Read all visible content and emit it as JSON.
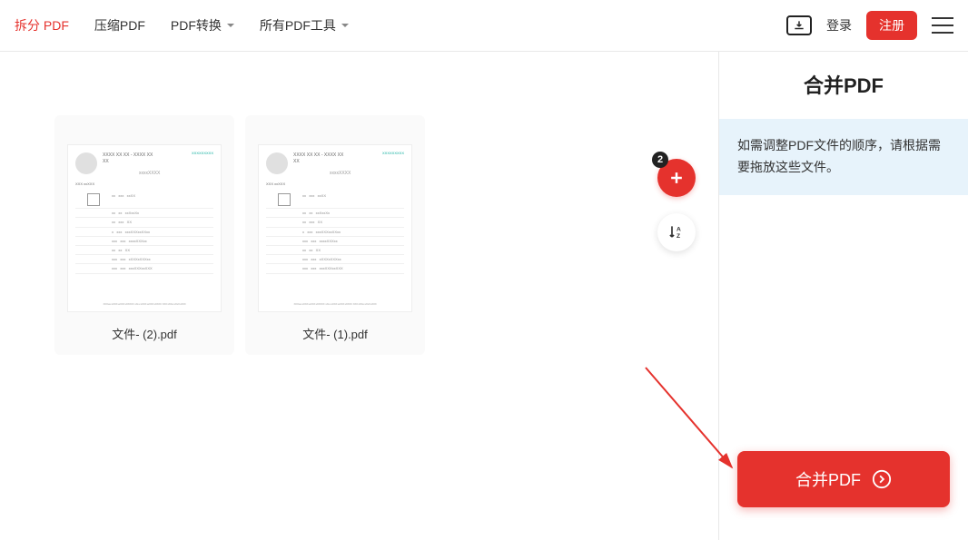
{
  "header": {
    "nav": [
      {
        "label": "拆分 PDF",
        "active": true,
        "hasDropdown": false
      },
      {
        "label": "压缩PDF",
        "active": false,
        "hasDropdown": false
      },
      {
        "label": "PDF转换",
        "active": false,
        "hasDropdown": true
      },
      {
        "label": "所有PDF工具",
        "active": false,
        "hasDropdown": true
      }
    ],
    "login": "登录",
    "register": "注册"
  },
  "files": [
    {
      "name": "文件- (2).pdf"
    },
    {
      "name": "文件- (1).pdf"
    }
  ],
  "badge_count": "2",
  "sidebar": {
    "title": "合并PDF",
    "info": "如需调整PDF文件的顺序，请根据需要拖放这些文件。",
    "action": "合并PDF"
  }
}
